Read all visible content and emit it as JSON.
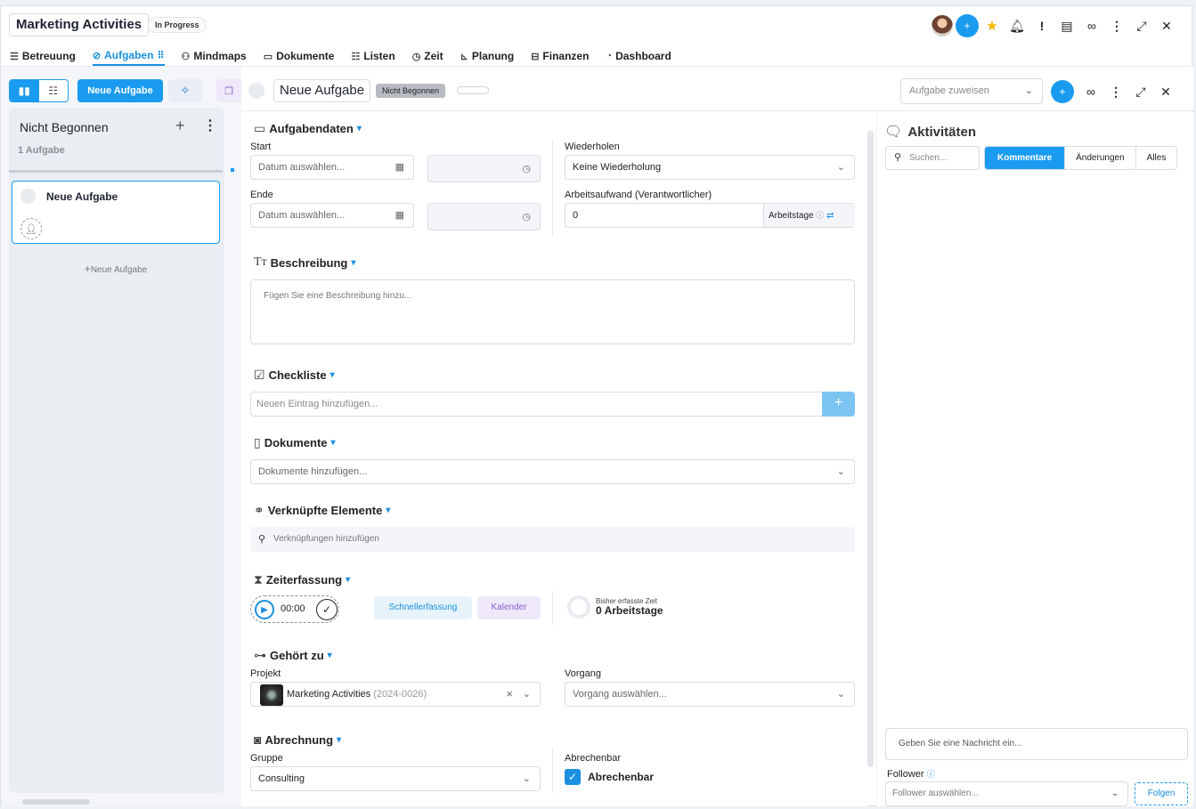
{
  "header": {
    "project_title": "Marketing Activities",
    "project_status": "In Progress"
  },
  "tabs": [
    {
      "label": "Betreuung",
      "icon": "sliders-icon"
    },
    {
      "label": "Aufgaben",
      "icon": "check-circle-icon",
      "active": true
    },
    {
      "label": "Mindmaps",
      "icon": "mindmap-icon"
    },
    {
      "label": "Dokumente",
      "icon": "folder-icon"
    },
    {
      "label": "Listen",
      "icon": "list-icon"
    },
    {
      "label": "Zeit",
      "icon": "clock-icon"
    },
    {
      "label": "Planung",
      "icon": "gantt-icon"
    },
    {
      "label": "Finanzen",
      "icon": "money-icon"
    },
    {
      "label": "Dashboard",
      "icon": "gauge-icon"
    }
  ],
  "board": {
    "new_task_button": "Neue Aufgabe",
    "column": {
      "title": "Nicht Begonnen",
      "count": "1 Aufgabe",
      "add_label": "Neue Aufgabe",
      "cards": [
        {
          "title": "Neue Aufgabe"
        }
      ]
    }
  },
  "task": {
    "title": "Neue Aufgabe",
    "status": "Nicht Begonnen",
    "assign_placeholder": "Aufgabe zuweisen"
  },
  "sections": {
    "aufgabendaten": "Aufgabendaten",
    "beschreibung": "Beschreibung",
    "checkliste": "Checkliste",
    "dokumente": "Dokumente",
    "verknuepfte": "Verknüpfte Elemente",
    "zeiterfassung": "Zeiterfassung",
    "gehoert_zu": "Gehört zu",
    "abrechnung": "Abrechnung"
  },
  "fields": {
    "start_label": "Start",
    "start_placeholder": "Datum auswählen...",
    "end_label": "Ende",
    "end_placeholder": "Datum auswählen...",
    "repeat_label": "Wiederholen",
    "repeat_value": "Keine Wiederholung",
    "effort_label": "Arbeitsaufwand (Verantwortlicher)",
    "effort_value": "0",
    "effort_unit": "Arbeitstage",
    "description_placeholder": "Fügen Sie eine Beschreibung hinzu...",
    "checklist_placeholder": "Neuen Eintrag hinzufügen...",
    "documents_placeholder": "Dokumente hinzufügen...",
    "links_placeholder": "Verknüpfungen hinzufügen",
    "timer_value": "00:00",
    "quick_button": "Schnellerfassung",
    "calendar_button": "Kalender",
    "tracked_label": "Bisher erfasste Zeit",
    "tracked_value": "0 Arbeitstage",
    "project_label": "Projekt",
    "project_value": "Marketing Activities",
    "project_code": "(2024-0026)",
    "process_label": "Vorgang",
    "process_placeholder": "Vorgang auswählen...",
    "group_label": "Gruppe",
    "group_value": "Consulting",
    "billable_label": "Abrechenbar",
    "billable_checkbox": "Abrechenbar"
  },
  "activity": {
    "title": "Aktivitäten",
    "search_placeholder": "Suchen...",
    "tabs": [
      "Kommentare",
      "Änderungen",
      "Alles"
    ],
    "message_placeholder": "Geben Sie eine Nachricht ein...",
    "follower_label": "Follower",
    "follower_placeholder": "Follower auswählen...",
    "follow_button": "Folgen"
  },
  "colors": {
    "accent": "#1a9bf0",
    "purple": "#8a5fd0"
  }
}
